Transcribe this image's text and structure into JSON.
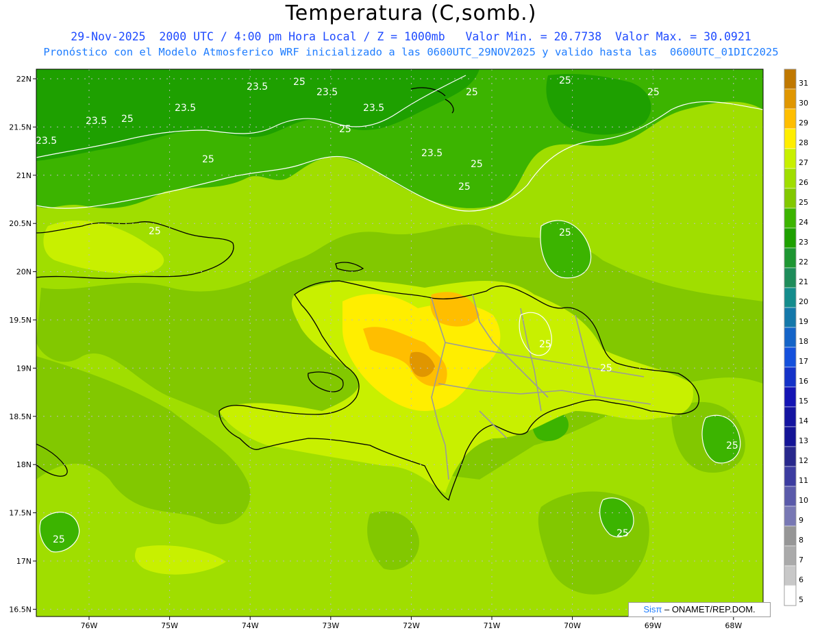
{
  "title": "Temperatura (C,somb.)",
  "subtitle_1": "29-Nov-2025  2000 UTC / 4:00 pm Hora Local / Z = 1000mb   Valor Min. = 20.7738  Valor Max. = 30.0921",
  "subtitle_2": "Pronóstico con el Modelo Atmosferico WRF inicializado a las 0600UTC_29NOV2025 y valido hasta las  0600UTC_01DIC2025",
  "credit": {
    "sis": "Sisπ",
    "rest": " – ONAMET/REP.DOM."
  },
  "map": {
    "lon_range": [
      -76.6,
      -67.6
    ],
    "lat_range": [
      16.4,
      22.1
    ],
    "lon_ticks": [
      "76W",
      "75W",
      "74W",
      "73W",
      "72W",
      "71W",
      "70W",
      "69W",
      "68W"
    ],
    "lat_ticks": [
      "22N",
      "21.5N",
      "21N",
      "20.5N",
      "20N",
      "19.5N",
      "19N",
      "18.5N",
      "18N",
      "17.5N",
      "17N",
      "16.5N"
    ],
    "contour_labels": [
      "23.5",
      "23.5",
      "23.5",
      "23.5",
      "23.5",
      "23.5",
      "23.5",
      "25",
      "25",
      "25",
      "25",
      "25",
      "25",
      "25",
      "25",
      "25",
      "25",
      "25",
      "25",
      "25",
      "25",
      "25",
      "25"
    ]
  },
  "colorbar": {
    "labels": [
      "31",
      "30",
      "29",
      "28",
      "27",
      "26",
      "25",
      "24",
      "23",
      "22",
      "21",
      "20",
      "19",
      "18",
      "17",
      "16",
      "15",
      "14",
      "13",
      "12",
      "11",
      "10",
      "9",
      "8",
      "7",
      "6",
      "5"
    ],
    "colors": [
      "#c07800",
      "#e09600",
      "#ffbe00",
      "#ffee00",
      "#c8f000",
      "#a0de00",
      "#82c800",
      "#3cb400",
      "#1ea000",
      "#1e9632",
      "#1e8c5a",
      "#148c8c",
      "#1478aa",
      "#1464c8",
      "#1450dc",
      "#1432c8",
      "#1414b4",
      "#1414a0",
      "#141496",
      "#28288c",
      "#3c3ca0",
      "#5a5aaa",
      "#7878b4",
      "#969696",
      "#aaaaaa",
      "#c8c8c8",
      "#ffffff"
    ]
  }
}
